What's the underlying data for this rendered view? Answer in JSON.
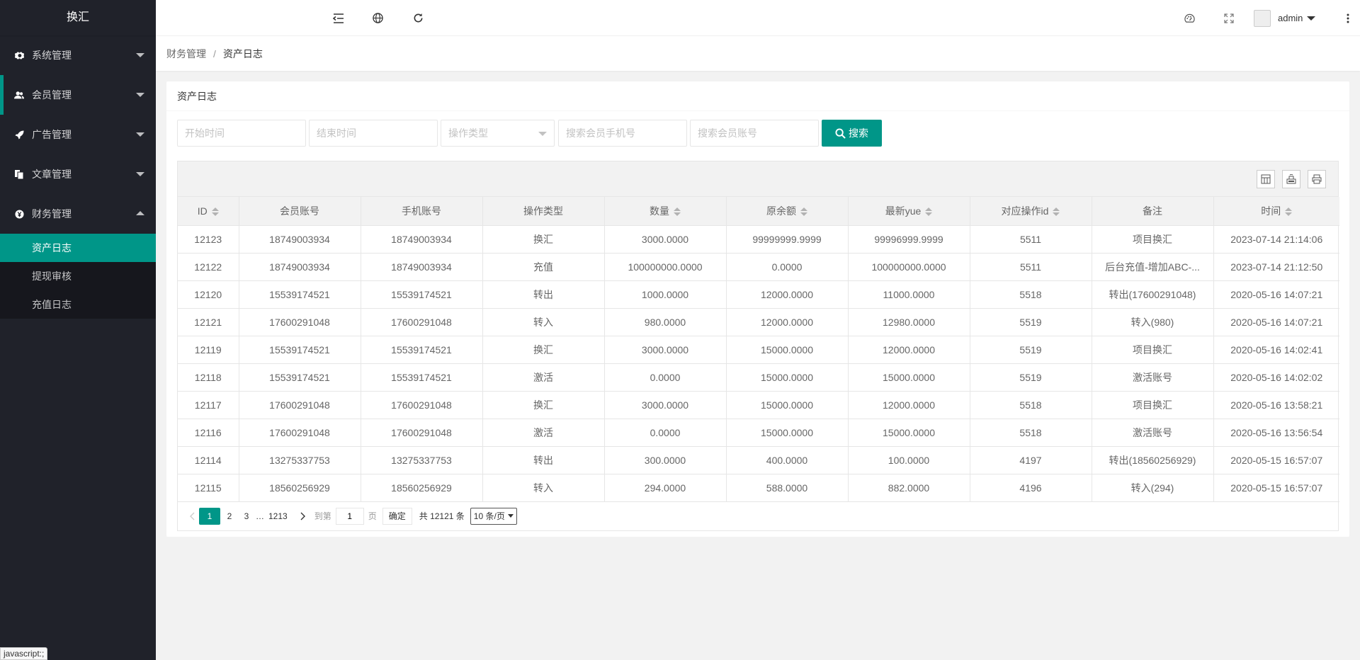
{
  "app": {
    "logo": "换汇"
  },
  "sidebar": {
    "menus": [
      {
        "label": "系统管理",
        "icon": "gear-icon",
        "expanded": false
      },
      {
        "label": "会员管理",
        "icon": "users-icon",
        "expanded": false
      },
      {
        "label": "广告管理",
        "icon": "rocket-icon",
        "expanded": false
      },
      {
        "label": "文章管理",
        "icon": "documents-icon",
        "expanded": false
      },
      {
        "label": "财务管理",
        "icon": "yen-icon",
        "expanded": true
      }
    ],
    "submenu": [
      "资产日志",
      "提现审核",
      "充值日志"
    ]
  },
  "header": {
    "user": "admin"
  },
  "breadcrumb": {
    "parent": "财务管理",
    "separator": "/",
    "current": "资产日志"
  },
  "card": {
    "title": "资产日志"
  },
  "search": {
    "start_placeholder": "开始时间",
    "end_placeholder": "结束时间",
    "type_placeholder": "操作类型",
    "phone_placeholder": "搜索会员手机号",
    "account_placeholder": "搜索会员账号",
    "button": "搜索"
  },
  "table": {
    "columns": [
      "ID",
      "会员账号",
      "手机账号",
      "操作类型",
      "数量",
      "原余额",
      "最新yue",
      "对应操作id",
      "备注",
      "时间"
    ],
    "rows": [
      [
        "12123",
        "18749003934",
        "18749003934",
        "换汇",
        "3000.0000",
        "99999999.9999",
        "99996999.9999",
        "5511",
        "项目换汇",
        "2023-07-14 21:14:06"
      ],
      [
        "12122",
        "18749003934",
        "18749003934",
        "充值",
        "100000000.0000",
        "0.0000",
        "100000000.0000",
        "5511",
        "后台充值-增加ABC-...",
        "2023-07-14 21:12:50"
      ],
      [
        "12120",
        "15539174521",
        "15539174521",
        "转出",
        "1000.0000",
        "12000.0000",
        "11000.0000",
        "5518",
        "转出(17600291048)",
        "2020-05-16 14:07:21"
      ],
      [
        "12121",
        "17600291048",
        "17600291048",
        "转入",
        "980.0000",
        "12000.0000",
        "12980.0000",
        "5519",
        "转入(980)",
        "2020-05-16 14:07:21"
      ],
      [
        "12119",
        "15539174521",
        "15539174521",
        "换汇",
        "3000.0000",
        "15000.0000",
        "12000.0000",
        "5519",
        "项目换汇",
        "2020-05-16 14:02:41"
      ],
      [
        "12118",
        "15539174521",
        "15539174521",
        "激活",
        "0.0000",
        "15000.0000",
        "15000.0000",
        "5519",
        "激活账号",
        "2020-05-16 14:02:02"
      ],
      [
        "12117",
        "17600291048",
        "17600291048",
        "换汇",
        "3000.0000",
        "15000.0000",
        "12000.0000",
        "5518",
        "项目换汇",
        "2020-05-16 13:58:21"
      ],
      [
        "12116",
        "17600291048",
        "17600291048",
        "激活",
        "0.0000",
        "15000.0000",
        "15000.0000",
        "5518",
        "激活账号",
        "2020-05-16 13:56:54"
      ],
      [
        "12114",
        "13275337753",
        "13275337753",
        "转出",
        "300.0000",
        "400.0000",
        "100.0000",
        "4197",
        "转出(18560256929)",
        "2020-05-15 16:57:07"
      ],
      [
        "12115",
        "18560256929",
        "18560256929",
        "转入",
        "294.0000",
        "588.0000",
        "882.0000",
        "4196",
        "转入(294)",
        "2020-05-15 16:57:07"
      ]
    ]
  },
  "pagination": {
    "pages": [
      "1",
      "2",
      "3"
    ],
    "ellipsis": "…",
    "last_page": "1213",
    "goto_label": "到第",
    "goto_value": "1",
    "page_unit": "页",
    "confirm": "确定",
    "total": "共 12121 条",
    "page_size": "10 条/页"
  },
  "status_tip": "javascript:;",
  "colors": {
    "accent": "#009688",
    "sidebar_bg": "#20222a"
  }
}
